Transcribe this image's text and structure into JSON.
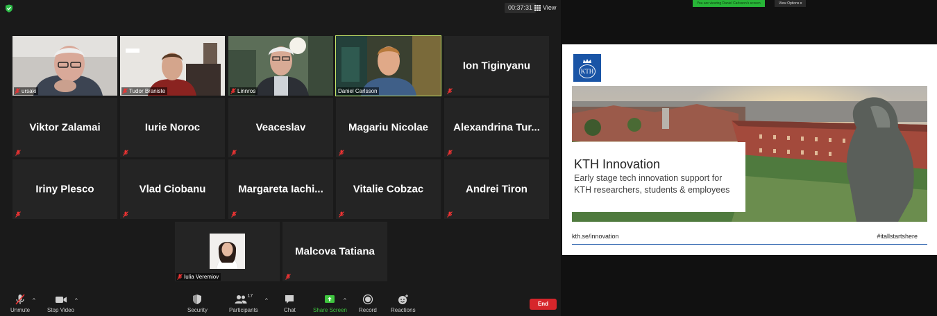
{
  "meeting": {
    "timer": "00:37:31",
    "view_label": "View"
  },
  "gallery": {
    "tiles": [
      {
        "name": "ursaki",
        "video": true
      },
      {
        "name": "Tudor Braniste",
        "video": true
      },
      {
        "name": "Linnros",
        "video": true
      },
      {
        "name": "Daniel Carlsson",
        "video": true,
        "active": true
      },
      {
        "name": "Ion Tiginyanu",
        "video": false
      },
      {
        "name": "Viktor Zalamai",
        "video": false
      },
      {
        "name": "Iurie Noroc",
        "video": false
      },
      {
        "name": "Veaceslav",
        "video": false
      },
      {
        "name": "Magariu Nicolae",
        "video": false
      },
      {
        "name": "Alexandrina  Tur...",
        "video": false
      },
      {
        "name": "Iriny Plesco",
        "video": false
      },
      {
        "name": "Vlad Ciobanu",
        "video": false
      },
      {
        "name": "Margareta  Iachi...",
        "video": false
      },
      {
        "name": "Vitalie Cobzac",
        "video": false
      },
      {
        "name": "Andrei Tiron",
        "video": false
      },
      {
        "name": "Iulia Veremiov",
        "video": false,
        "avatar": true
      },
      {
        "name": "Malcova Tatiana",
        "video": false
      }
    ]
  },
  "toolbar": {
    "unmute": "Unmute",
    "stop_video": "Stop Video",
    "security": "Security",
    "participants": "Participants",
    "participants_count": "17",
    "chat": "Chat",
    "share_screen": "Share Screen",
    "record": "Record",
    "reactions": "Reactions",
    "end": "End"
  },
  "share": {
    "viewing_banner": "You are viewing Daniel Carlsson's screen",
    "view_options": "View Options"
  },
  "slide": {
    "logo_text": "KTH",
    "title": "KTH Innovation",
    "subtitle_line1": "Early stage tech innovation support for",
    "subtitle_line2": "KTH researchers, students & employees",
    "url": "kth.se/innovation",
    "hashtag": "#itallstartshere"
  },
  "colors": {
    "active_speaker": "#c7e86a",
    "end_button": "#d6262b",
    "share_green": "#3fc63f",
    "kth_blue": "#1954a6"
  }
}
